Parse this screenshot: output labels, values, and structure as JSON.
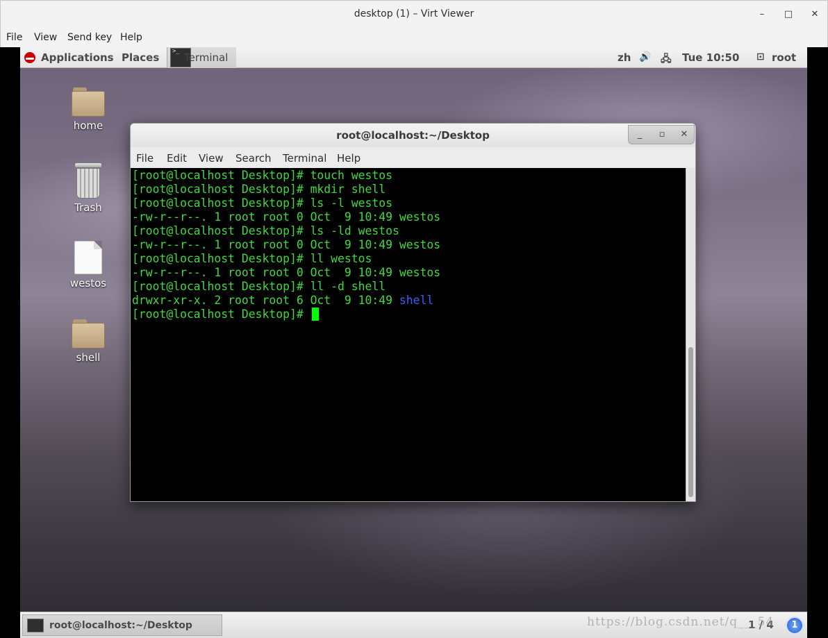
{
  "window": {
    "title": "desktop (1) – Virt Viewer",
    "minimize": "–",
    "maximize": "□",
    "close": "✕"
  },
  "outer_menu": [
    "File",
    "View",
    "Send key",
    "Help"
  ],
  "top_panel": {
    "applications": "Applications",
    "places": "Places",
    "terminal_task": "Terminal",
    "lang": "zh",
    "volume_icon": "speaker-icon",
    "network_icon": "network-icon",
    "clock": "Tue 10:50",
    "user": "root"
  },
  "desktop_icons": [
    {
      "label": "home",
      "icon": "home-folder-icon"
    },
    {
      "label": "Trash",
      "icon": "trash-icon"
    },
    {
      "label": "westos",
      "icon": "file-icon"
    },
    {
      "label": "shell",
      "icon": "folder-icon"
    }
  ],
  "terminal": {
    "title": "root@localhost:~/Desktop",
    "menu": [
      "File",
      "Edit",
      "View",
      "Search",
      "Terminal",
      "Help"
    ],
    "lines": [
      "[root@localhost Desktop]# touch westos",
      "[root@localhost Desktop]# mkdir shell",
      "[root@localhost Desktop]# ls -l westos",
      "-rw-r--r--. 1 root root 0 Oct  9 10:49 westos",
      "[root@localhost Desktop]# ls -ld westos",
      "-rw-r--r--. 1 root root 0 Oct  9 10:49 westos",
      "[root@localhost Desktop]# ll westos",
      "-rw-r--r--. 1 root root 0 Oct  9 10:49 westos",
      "[root@localhost Desktop]# ll -d shell"
    ],
    "dir_line_prefix": "drwxr-xr-x. 2 root root 6 Oct  9 10:49 ",
    "dir_line_name": "shell",
    "prompt": "[root@localhost Desktop]# ",
    "colors": {
      "text": "#3fd93f",
      "dir": "#3a5cff",
      "cursor": "#00ff00",
      "bg": "#000000"
    }
  },
  "bottom_panel": {
    "task_label": "root@localhost:~/Desktop",
    "workspace": "1 / 4",
    "badge": "1"
  },
  "watermark": "https://blog.csdn.net/q___54"
}
